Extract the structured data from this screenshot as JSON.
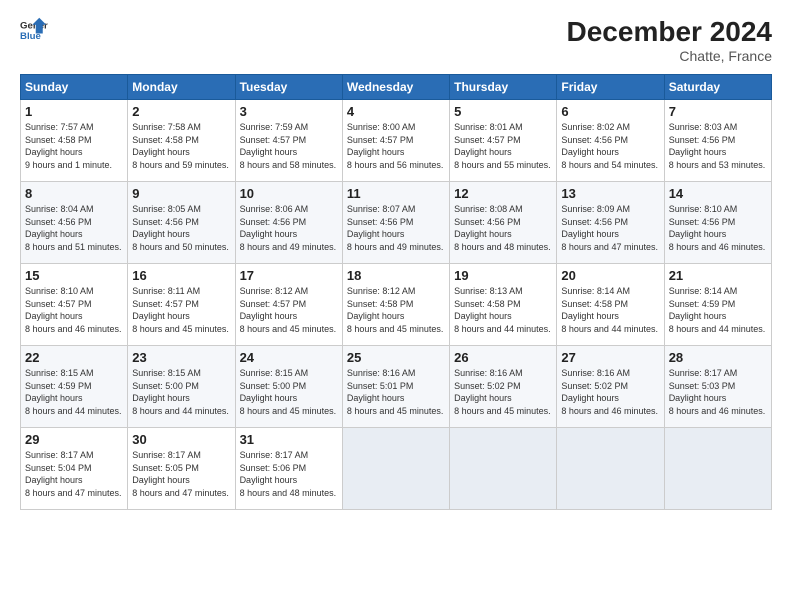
{
  "header": {
    "logo_text_general": "General",
    "logo_text_blue": "Blue",
    "month_title": "December 2024",
    "subtitle": "Chatte, France"
  },
  "days_of_week": [
    "Sunday",
    "Monday",
    "Tuesday",
    "Wednesday",
    "Thursday",
    "Friday",
    "Saturday"
  ],
  "weeks": [
    [
      {
        "day": "1",
        "sunrise": "7:57 AM",
        "sunset": "4:58 PM",
        "daylight": "9 hours and 1 minute."
      },
      {
        "day": "2",
        "sunrise": "7:58 AM",
        "sunset": "4:58 PM",
        "daylight": "8 hours and 59 minutes."
      },
      {
        "day": "3",
        "sunrise": "7:59 AM",
        "sunset": "4:57 PM",
        "daylight": "8 hours and 58 minutes."
      },
      {
        "day": "4",
        "sunrise": "8:00 AM",
        "sunset": "4:57 PM",
        "daylight": "8 hours and 56 minutes."
      },
      {
        "day": "5",
        "sunrise": "8:01 AM",
        "sunset": "4:57 PM",
        "daylight": "8 hours and 55 minutes."
      },
      {
        "day": "6",
        "sunrise": "8:02 AM",
        "sunset": "4:56 PM",
        "daylight": "8 hours and 54 minutes."
      },
      {
        "day": "7",
        "sunrise": "8:03 AM",
        "sunset": "4:56 PM",
        "daylight": "8 hours and 53 minutes."
      }
    ],
    [
      {
        "day": "8",
        "sunrise": "8:04 AM",
        "sunset": "4:56 PM",
        "daylight": "8 hours and 51 minutes."
      },
      {
        "day": "9",
        "sunrise": "8:05 AM",
        "sunset": "4:56 PM",
        "daylight": "8 hours and 50 minutes."
      },
      {
        "day": "10",
        "sunrise": "8:06 AM",
        "sunset": "4:56 PM",
        "daylight": "8 hours and 49 minutes."
      },
      {
        "day": "11",
        "sunrise": "8:07 AM",
        "sunset": "4:56 PM",
        "daylight": "8 hours and 49 minutes."
      },
      {
        "day": "12",
        "sunrise": "8:08 AM",
        "sunset": "4:56 PM",
        "daylight": "8 hours and 48 minutes."
      },
      {
        "day": "13",
        "sunrise": "8:09 AM",
        "sunset": "4:56 PM",
        "daylight": "8 hours and 47 minutes."
      },
      {
        "day": "14",
        "sunrise": "8:10 AM",
        "sunset": "4:56 PM",
        "daylight": "8 hours and 46 minutes."
      }
    ],
    [
      {
        "day": "15",
        "sunrise": "8:10 AM",
        "sunset": "4:57 PM",
        "daylight": "8 hours and 46 minutes."
      },
      {
        "day": "16",
        "sunrise": "8:11 AM",
        "sunset": "4:57 PM",
        "daylight": "8 hours and 45 minutes."
      },
      {
        "day": "17",
        "sunrise": "8:12 AM",
        "sunset": "4:57 PM",
        "daylight": "8 hours and 45 minutes."
      },
      {
        "day": "18",
        "sunrise": "8:12 AM",
        "sunset": "4:58 PM",
        "daylight": "8 hours and 45 minutes."
      },
      {
        "day": "19",
        "sunrise": "8:13 AM",
        "sunset": "4:58 PM",
        "daylight": "8 hours and 44 minutes."
      },
      {
        "day": "20",
        "sunrise": "8:14 AM",
        "sunset": "4:58 PM",
        "daylight": "8 hours and 44 minutes."
      },
      {
        "day": "21",
        "sunrise": "8:14 AM",
        "sunset": "4:59 PM",
        "daylight": "8 hours and 44 minutes."
      }
    ],
    [
      {
        "day": "22",
        "sunrise": "8:15 AM",
        "sunset": "4:59 PM",
        "daylight": "8 hours and 44 minutes."
      },
      {
        "day": "23",
        "sunrise": "8:15 AM",
        "sunset": "5:00 PM",
        "daylight": "8 hours and 44 minutes."
      },
      {
        "day": "24",
        "sunrise": "8:15 AM",
        "sunset": "5:00 PM",
        "daylight": "8 hours and 45 minutes."
      },
      {
        "day": "25",
        "sunrise": "8:16 AM",
        "sunset": "5:01 PM",
        "daylight": "8 hours and 45 minutes."
      },
      {
        "day": "26",
        "sunrise": "8:16 AM",
        "sunset": "5:02 PM",
        "daylight": "8 hours and 45 minutes."
      },
      {
        "day": "27",
        "sunrise": "8:16 AM",
        "sunset": "5:02 PM",
        "daylight": "8 hours and 46 minutes."
      },
      {
        "day": "28",
        "sunrise": "8:17 AM",
        "sunset": "5:03 PM",
        "daylight": "8 hours and 46 minutes."
      }
    ],
    [
      {
        "day": "29",
        "sunrise": "8:17 AM",
        "sunset": "5:04 PM",
        "daylight": "8 hours and 47 minutes."
      },
      {
        "day": "30",
        "sunrise": "8:17 AM",
        "sunset": "5:05 PM",
        "daylight": "8 hours and 47 minutes."
      },
      {
        "day": "31",
        "sunrise": "8:17 AM",
        "sunset": "5:06 PM",
        "daylight": "8 hours and 48 minutes."
      },
      null,
      null,
      null,
      null
    ]
  ]
}
